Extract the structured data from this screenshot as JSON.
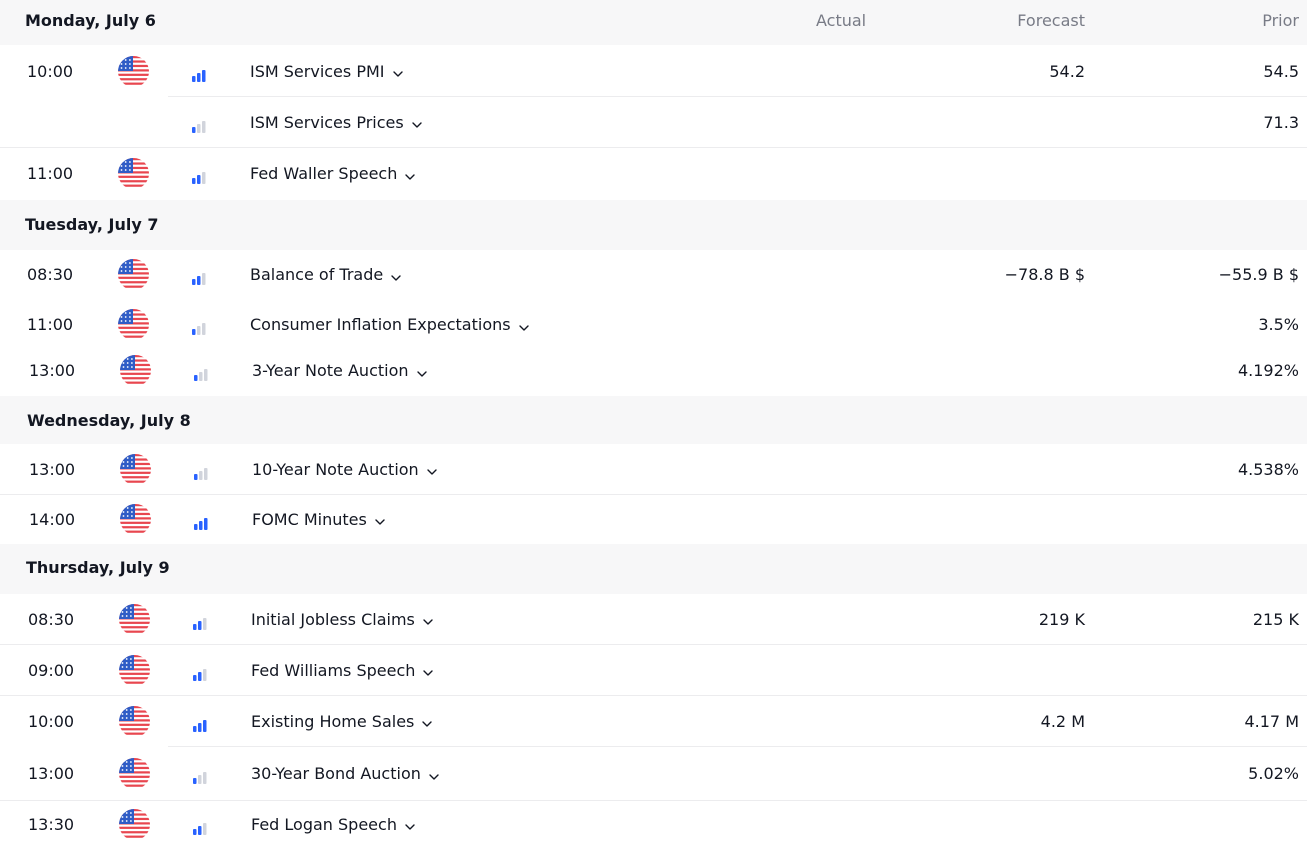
{
  "columns": {
    "actual": "Actual",
    "forecast": "Forecast",
    "prior": "Prior"
  },
  "colors": {
    "flag_red": "#e8464f",
    "flag_blue": "#2f5cc6",
    "importance_active": "#2962ff",
    "importance_inactive": "#d1d4dc"
  },
  "days": [
    {
      "label": "Monday, July 6"
    },
    {
      "label": "Tuesday, July 7"
    },
    {
      "label": "Wednesday, July 8"
    },
    {
      "label": "Thursday, July 9"
    }
  ],
  "events": [
    {
      "time": "10:00",
      "country": "us-flag",
      "importance": 3,
      "title": "ISM Services PMI",
      "actual": "",
      "forecast": "54.2",
      "prior": "54.5"
    },
    {
      "time": "",
      "country": "",
      "importance": 1,
      "title": "ISM Services Prices",
      "actual": "",
      "forecast": "",
      "prior": "71.3"
    },
    {
      "time": "11:00",
      "country": "us-flag",
      "importance": 2,
      "title": "Fed Waller Speech",
      "actual": "",
      "forecast": "",
      "prior": ""
    },
    {
      "time": "08:30",
      "country": "us-flag",
      "importance": 2,
      "title": "Balance of Trade",
      "actual": "",
      "forecast": "−78.8 B $",
      "prior": "−55.9 B $"
    },
    {
      "time": "11:00",
      "country": "us-flag",
      "importance": 1,
      "title": "Consumer Inflation Expectations",
      "actual": "",
      "forecast": "",
      "prior": "3.5%"
    },
    {
      "time": "13:00",
      "country": "us-flag",
      "importance": 1,
      "title": "3-Year Note Auction",
      "actual": "",
      "forecast": "",
      "prior": "4.192%"
    },
    {
      "time": "13:00",
      "country": "us-flag",
      "importance": 1,
      "title": "10-Year Note Auction",
      "actual": "",
      "forecast": "",
      "prior": "4.538%"
    },
    {
      "time": "14:00",
      "country": "us-flag",
      "importance": 3,
      "title": "FOMC Minutes",
      "actual": "",
      "forecast": "",
      "prior": ""
    },
    {
      "time": "08:30",
      "country": "us-flag",
      "importance": 2,
      "title": "Initial Jobless Claims",
      "actual": "",
      "forecast": "219 K",
      "prior": "215 K"
    },
    {
      "time": "09:00",
      "country": "us-flag",
      "importance": 2,
      "title": "Fed Williams Speech",
      "actual": "",
      "forecast": "",
      "prior": ""
    },
    {
      "time": "10:00",
      "country": "us-flag",
      "importance": 3,
      "title": "Existing Home Sales",
      "actual": "",
      "forecast": "4.2 M",
      "prior": "4.17 M"
    },
    {
      "time": "13:00",
      "country": "us-flag",
      "importance": 1,
      "title": "30-Year Bond Auction",
      "actual": "",
      "forecast": "",
      "prior": "5.02%"
    },
    {
      "time": "13:30",
      "country": "us-flag",
      "importance": 2,
      "title": "Fed Logan Speech",
      "actual": "",
      "forecast": "",
      "prior": ""
    }
  ]
}
